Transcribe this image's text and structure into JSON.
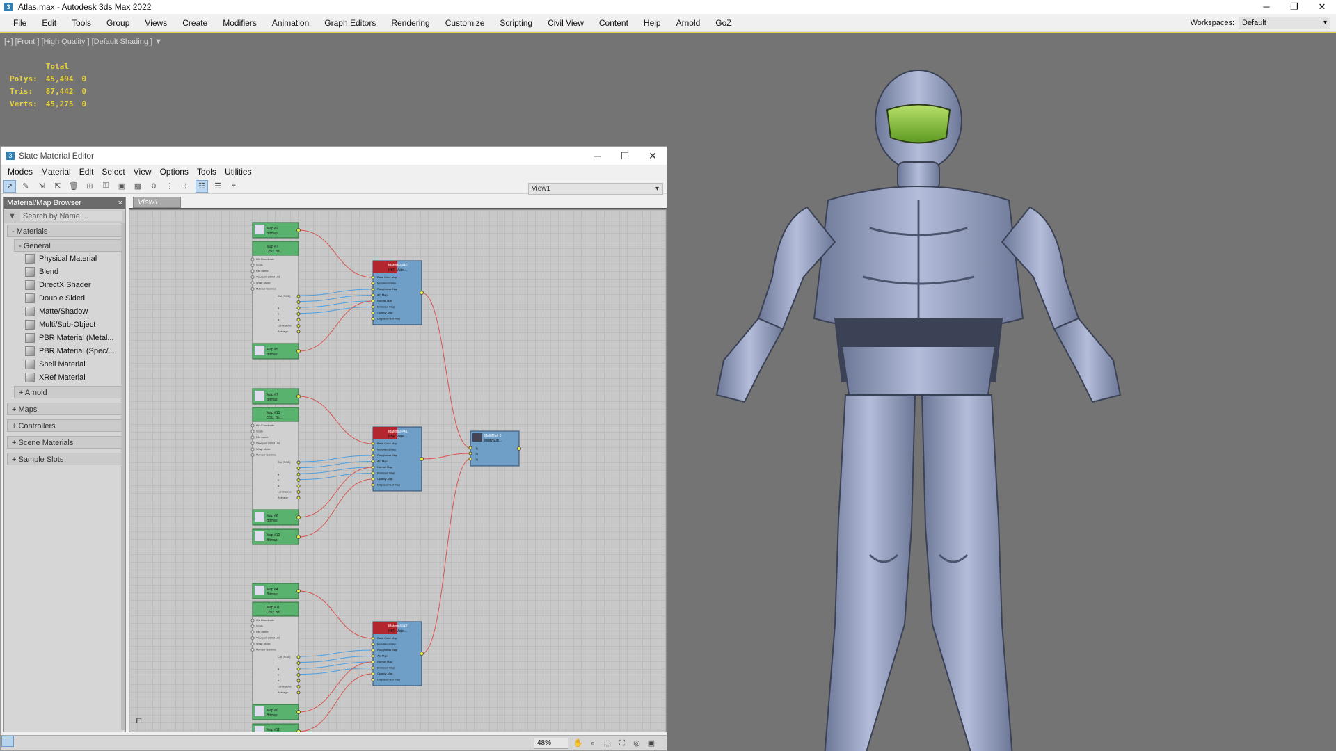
{
  "window": {
    "title": "Atlas.max - Autodesk 3ds Max 2022",
    "minimize": "─",
    "restore": "❐",
    "close": "✕"
  },
  "menu": [
    "File",
    "Edit",
    "Tools",
    "Group",
    "Views",
    "Create",
    "Modifiers",
    "Animation",
    "Graph Editors",
    "Rendering",
    "Customize",
    "Scripting",
    "Civil View",
    "Content",
    "Help",
    "Arnold",
    "GoZ"
  ],
  "workspace": {
    "label": "Workspaces:",
    "value": "Default"
  },
  "viewport": {
    "label": "[+] [Front ] [High Quality ] [Default Shading ]",
    "stats": {
      "header": "Total",
      "rows": [
        {
          "name": "Polys:",
          "total": "45,494",
          "sel": "0"
        },
        {
          "name": "Tris:",
          "total": "87,442",
          "sel": "0"
        },
        {
          "name": "Verts:",
          "total": "45,275",
          "sel": "0"
        }
      ]
    }
  },
  "slate": {
    "title": "Slate Material Editor",
    "minimize": "─",
    "maximize": "☐",
    "close": "✕",
    "menu": [
      "Modes",
      "Material",
      "Edit",
      "Select",
      "View",
      "Options",
      "Tools",
      "Utilities"
    ],
    "view_select": "View1",
    "view_tab": "View1",
    "browser": {
      "title": "Material/Map Browser",
      "close": "×",
      "search_placeholder": "Search by Name ...",
      "materials_group": "- Materials",
      "general_group": "- General",
      "items": [
        "Physical Material",
        "Blend",
        "DirectX Shader",
        "Double Sided",
        "Matte/Shadow",
        "Multi/Sub-Object",
        "PBR Material (Metal...",
        "PBR Material (Spec/...",
        "Shell Material",
        "XRef Material"
      ],
      "arnold_group": "+ Arnold",
      "groups": [
        "+ Maps",
        "+ Controllers",
        "+ Scene Materials",
        "+ Sample Slots"
      ]
    },
    "nodes": {
      "bitmap_sub": "Bitmap",
      "osl_sub": "OSL: Bit...",
      "osl_params": [
        "UV Coordinate",
        "Scale",
        "File name",
        "Viewport UDIM List",
        "Wrap Mode",
        "Manual Gamma"
      ],
      "osl_out": [
        "Col (RGB)",
        "r",
        "g",
        "b",
        "a",
        "Luminance",
        "Average"
      ],
      "pbr_params": [
        "Base Color Map",
        "Metalness Map",
        "Roughness Map",
        "AO Map",
        "Normal Map",
        "Emission Map",
        "Opacity Map",
        "Displacement Map"
      ],
      "groups": [
        {
          "top": "Map #2",
          "osl": "Map #7",
          "bottom": "Map #5",
          "bottom2": "",
          "pbr_title": "Material #40",
          "pbr_sub": "PBR Mate..."
        },
        {
          "top": "Map #7",
          "osl": "Map #13",
          "bottom": "Map #8",
          "bottom2": "Map #12",
          "pbr_title": "Material #41",
          "pbr_sub": "PBR Mate..."
        },
        {
          "top": "Map #4",
          "osl": "Map #11",
          "bottom": "Map #9",
          "bottom2": "Map #11",
          "pbr_title": "Material #42",
          "pbr_sub": "PBR Mate..."
        }
      ],
      "multi": {
        "title": "MultiMat_0",
        "sub": "Multi/Sub...",
        "slots": [
          "(1)",
          "(2)",
          "(3)"
        ]
      }
    },
    "zoom": "48%"
  },
  "colors": {
    "node_green": "#5ab26f",
    "node_red": "#b3262e",
    "node_blue": "#6f9ec6",
    "wire_red": "#d9534f",
    "wire_blue": "#4f9fe0",
    "armor": "#8e9bc0",
    "visor": "#88c23a"
  }
}
